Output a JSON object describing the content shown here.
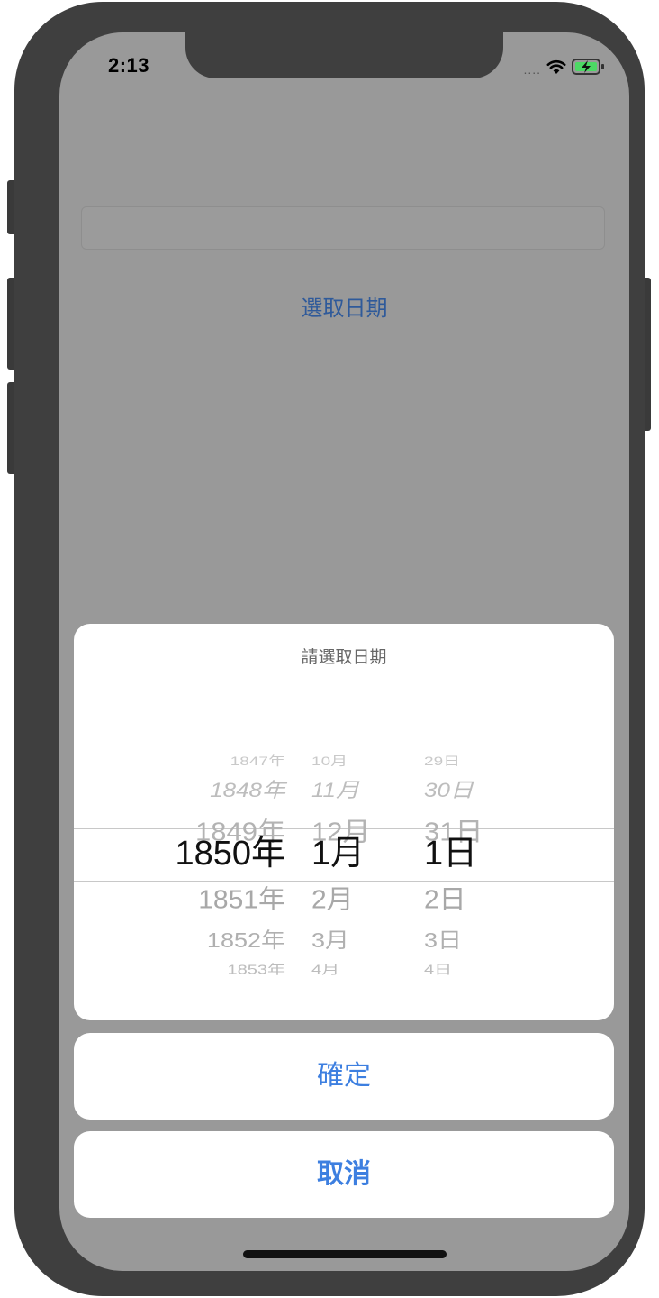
{
  "status_bar": {
    "time": "2:13",
    "signal": "....",
    "wifi_icon": "wifi-icon",
    "battery_icon": "battery-charging-icon"
  },
  "page": {
    "text_field_value": "",
    "pick_date_link": "選取日期"
  },
  "sheet": {
    "title": "請選取日期",
    "picker": {
      "years": [
        "1847年",
        "1848年",
        "1849年",
        "1850年",
        "1851年",
        "1852年",
        "1853年"
      ],
      "months": [
        "10月",
        "11月",
        "12月",
        "1月",
        "2月",
        "3月",
        "4月"
      ],
      "days": [
        "29日",
        "30日",
        "31日",
        "1日",
        "2日",
        "3日",
        "4日"
      ],
      "selected": {
        "year": "1850年",
        "month": "1月",
        "day": "1日"
      }
    },
    "confirm_label": "確定",
    "cancel_label": "取消"
  },
  "colors": {
    "accent": "#3d7fe0",
    "overlay": "#999999",
    "frame": "#3f3f3f"
  }
}
